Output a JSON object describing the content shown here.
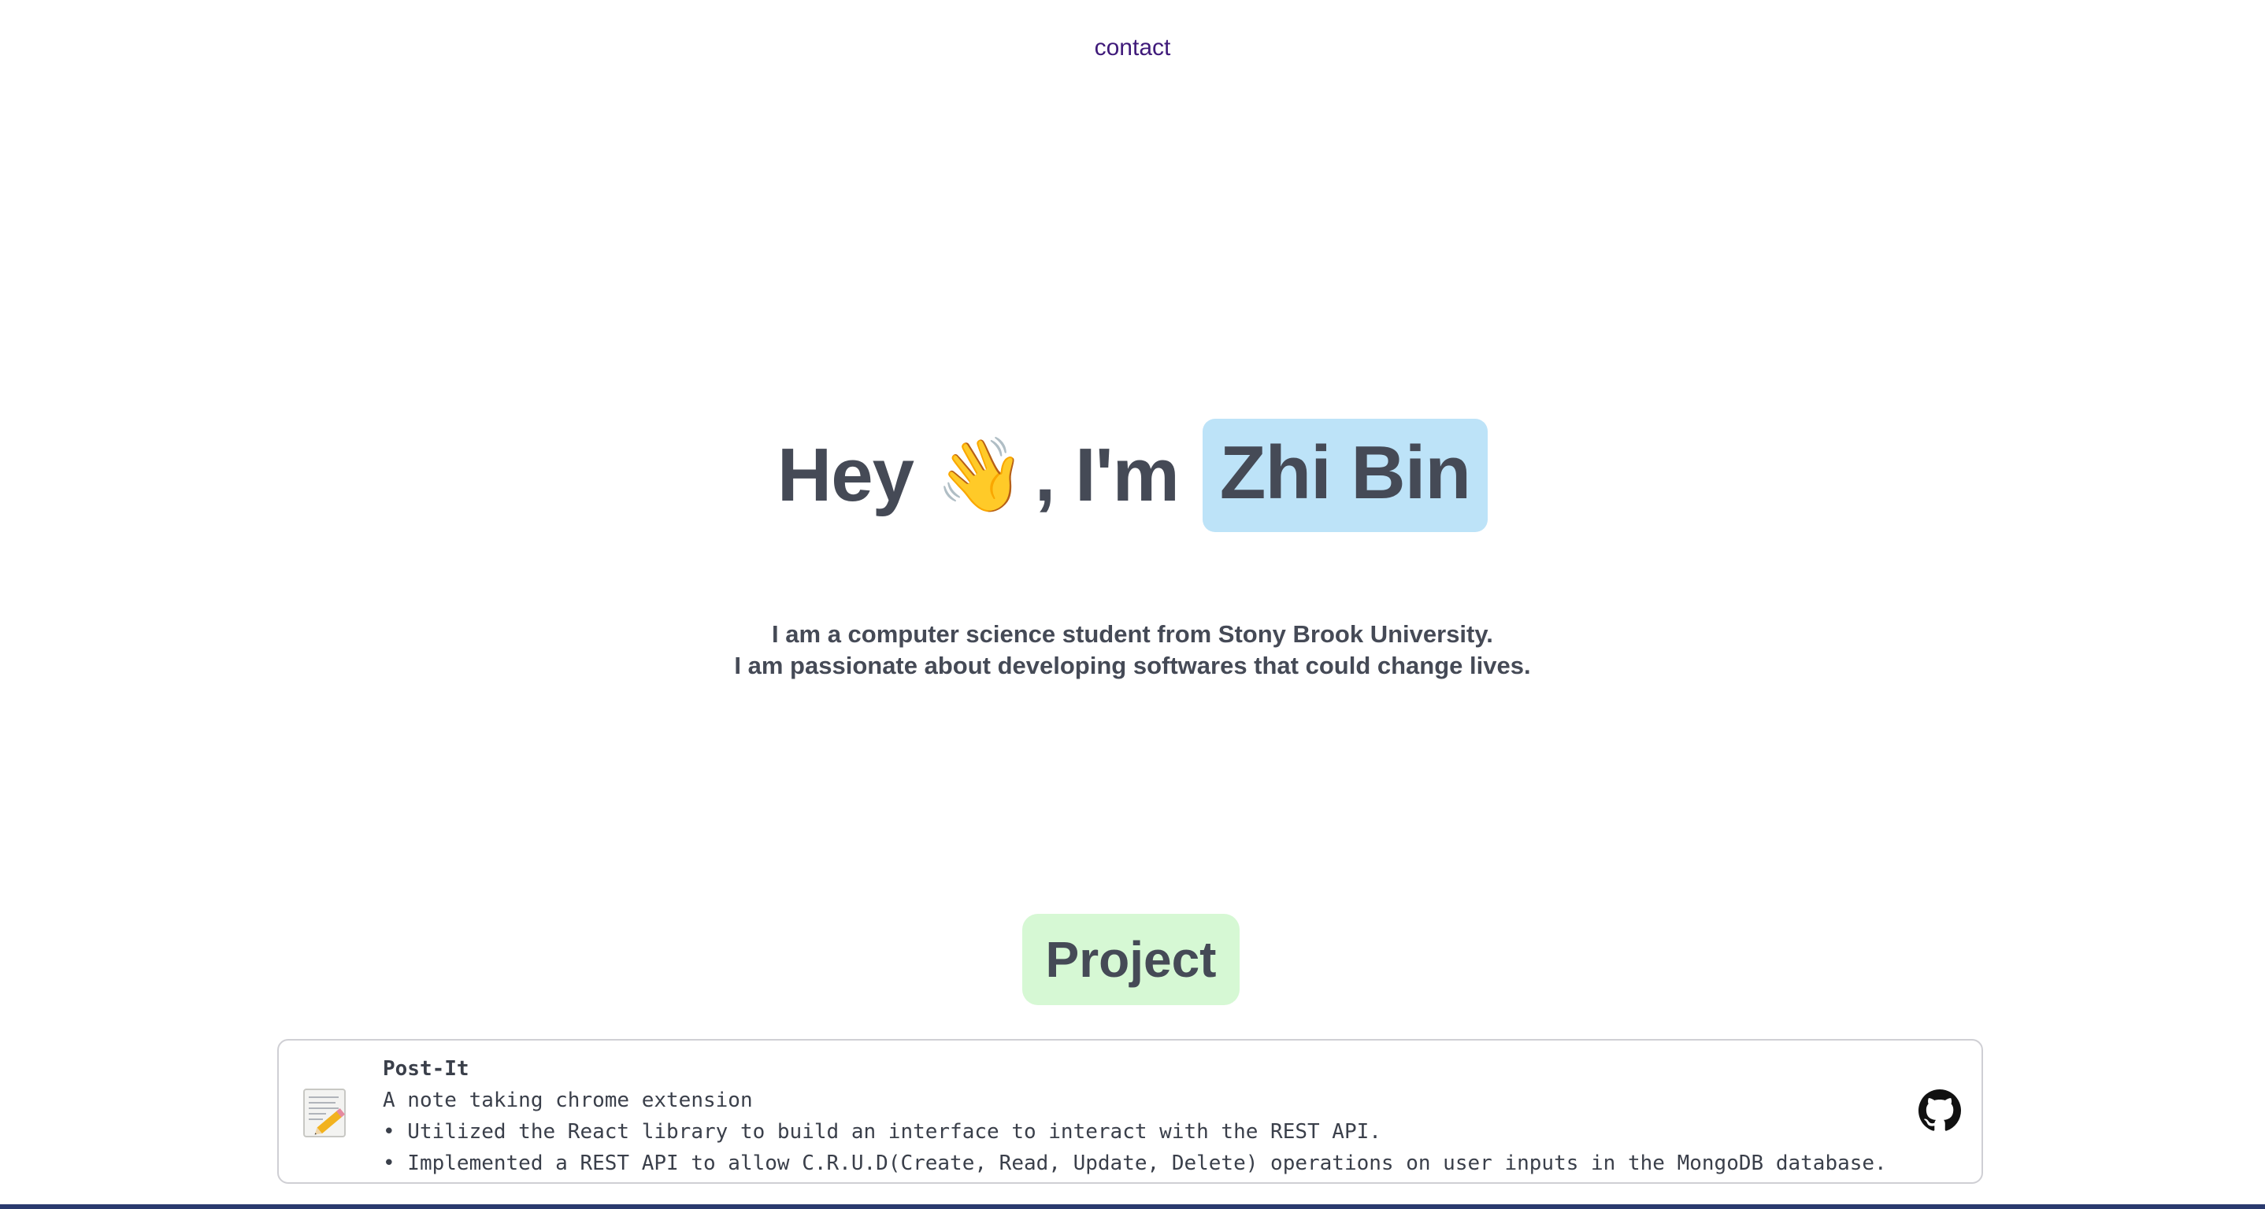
{
  "nav": {
    "contact_label": "contact"
  },
  "hero": {
    "greeting": "Hey",
    "wave_emoji": "👋",
    "im_text": ", I'm",
    "name": "Zhi Bin",
    "name_highlight_color": "#bde3f8"
  },
  "bio": {
    "line1": "I am a computer science student from Stony Brook University.",
    "line2": "I am passionate about developing softwares that could change lives."
  },
  "projects_section": {
    "title": "Project",
    "title_highlight_color": "#d6f8d4",
    "items": [
      {
        "name": "Post-It",
        "icon": "notepad-pencil-icon",
        "description": "A note taking chrome extension",
        "bullets": [
          "• Utilized the React library to build an interface to interact with the REST API.",
          "• Implemented a REST API to allow C.R.U.D(Create, Read, Update, Delete) operations on user inputs in the MongoDB database."
        ],
        "link_icon": "github-icon"
      }
    ]
  },
  "colors": {
    "text": "#454a56",
    "link": "#3f1a7a"
  }
}
